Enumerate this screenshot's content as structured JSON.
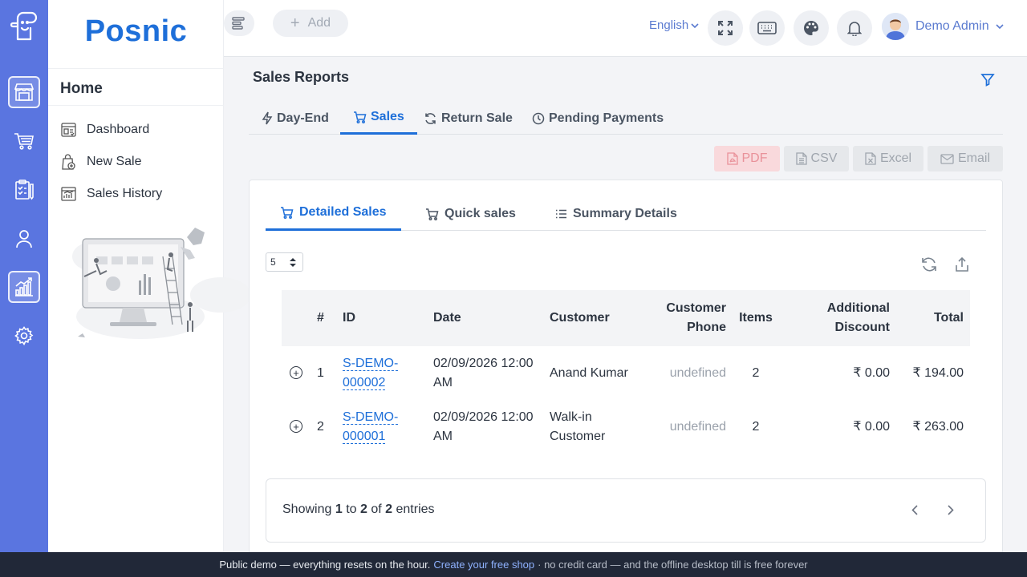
{
  "brand": "Posnic",
  "sidebar": {
    "title": "Home",
    "items": [
      {
        "label": "Dashboard",
        "icon": "dashboard-icon"
      },
      {
        "label": "New Sale",
        "icon": "new-sale-icon"
      },
      {
        "label": "Sales History",
        "icon": "sales-history-icon"
      }
    ]
  },
  "rail": [
    "store-icon",
    "cart-icon",
    "clipboard-icon",
    "user-icon",
    "chart-icon",
    "gear-icon"
  ],
  "topbar": {
    "add_label": "Add",
    "language": "English",
    "user_name": "Demo Admin"
  },
  "page": {
    "title": "Sales Reports",
    "tabs": [
      "Day-End",
      "Sales",
      "Return Sale",
      "Pending Payments"
    ],
    "active_tab": "Sales"
  },
  "exports": [
    "PDF",
    "CSV",
    "Excel",
    "Email"
  ],
  "subtabs": [
    "Detailed Sales",
    "Quick sales",
    "Summary Details"
  ],
  "page_size": "5",
  "table": {
    "headers": {
      "num": "#",
      "id": "ID",
      "date": "Date",
      "customer": "Customer",
      "phone_1": "Customer",
      "phone_2": "Phone",
      "items": "Items",
      "discount_1": "Additional",
      "discount_2": "Discount",
      "total": "Total"
    },
    "rows": [
      {
        "num": "1",
        "id_1": "S-DEMO-",
        "id_2": "000002",
        "date_1": "02/09/2026 12:00",
        "date_2": "AM",
        "customer_1": "Anand Kumar",
        "customer_2": "",
        "phone": "undefined",
        "items": "2",
        "discount": "₹ 0.00",
        "total": "₹ 194.00"
      },
      {
        "num": "2",
        "id_1": "S-DEMO-",
        "id_2": "000001",
        "date_1": "02/09/2026 12:00",
        "date_2": "AM",
        "customer_1": "Walk-in",
        "customer_2": "Customer",
        "phone": "undefined",
        "items": "2",
        "discount": "₹ 0.00",
        "total": "₹ 263.00"
      }
    ]
  },
  "pagination": {
    "showing": "Showing",
    "from": "1",
    "to_word": "to",
    "to": "2",
    "of_word": "of",
    "total": "2",
    "entries": "entries"
  },
  "banner": {
    "text": "Public demo — everything resets on the hour.",
    "link": "Create your free shop",
    "rest": "· no credit card — and the offline desktop till is free forever"
  },
  "colors": {
    "accent": "#1e6fd9",
    "rail": "#5a75e0",
    "banner": "#212838"
  }
}
